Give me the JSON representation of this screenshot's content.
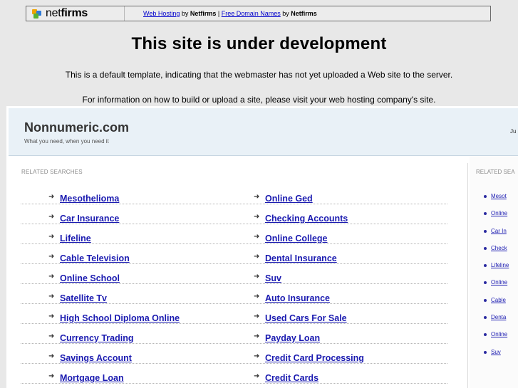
{
  "banner": {
    "logo_text_light": "net",
    "logo_text_bold": "firms",
    "link1": "Web Hosting",
    "by1": " by ",
    "brand1": "Netfirms",
    "sep": " | ",
    "link2": "Free Domain Names",
    "by2": " by ",
    "brand2": "Netfirms"
  },
  "headline": "This site is under development",
  "line1": "This is a default template, indicating that the webmaster has not yet uploaded a Web site to the server.",
  "line2": "For information on how to build or upload a site, please visit your web hosting company's site.",
  "site": {
    "name": "Nonnumeric.com",
    "tagline": "What you need, when you need it",
    "header_right": "Ju"
  },
  "related_title": "RELATED SEARCHES",
  "related_title_right": "RELATED SEA",
  "left_items": [
    "Mesothelioma",
    "Car Insurance",
    "Lifeline",
    "Cable Television",
    "Online School",
    "Satellite Tv",
    "High School Diploma Online",
    "Currency Trading",
    "Savings Account",
    "Mortgage Loan"
  ],
  "mid_items": [
    "Online Ged",
    "Checking Accounts",
    "Online College",
    "Dental Insurance",
    "Suv",
    "Auto Insurance",
    "Used Cars For Sale",
    "Payday Loan",
    "Credit Card Processing",
    "Credit Cards"
  ],
  "right_items": [
    "Mesot",
    "Online",
    "Car In",
    "Check",
    "Lifeline",
    "Online",
    "Cable",
    "Denta",
    "Online",
    "Suv"
  ]
}
